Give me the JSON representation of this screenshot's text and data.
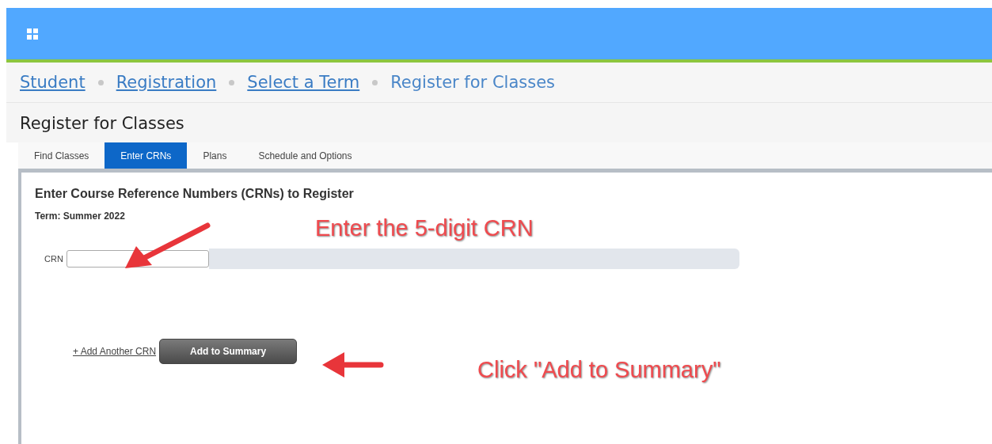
{
  "breadcrumbs": [
    {
      "label": "Student",
      "link": true
    },
    {
      "label": "Registration",
      "link": true
    },
    {
      "label": "Select a Term",
      "link": true
    },
    {
      "label": "Register for Classes",
      "link": false
    }
  ],
  "page_title": "Register for Classes",
  "tabs": [
    {
      "label": "Find Classes",
      "selected": false
    },
    {
      "label": "Enter CRNs",
      "selected": true
    },
    {
      "label": "Plans",
      "selected": false
    },
    {
      "label": "Schedule and Options",
      "selected": false
    }
  ],
  "panel": {
    "heading": "Enter Course Reference Numbers (CRNs) to Register",
    "term": "Term: Summer 2022",
    "crn_label": "CRN",
    "add_link": "+ Add Another CRN",
    "add_button": "Add to Summary"
  },
  "annotations": [
    {
      "text": "Enter the 5-digit CRN"
    },
    {
      "text": "Click \"Add to Summary\""
    }
  ]
}
